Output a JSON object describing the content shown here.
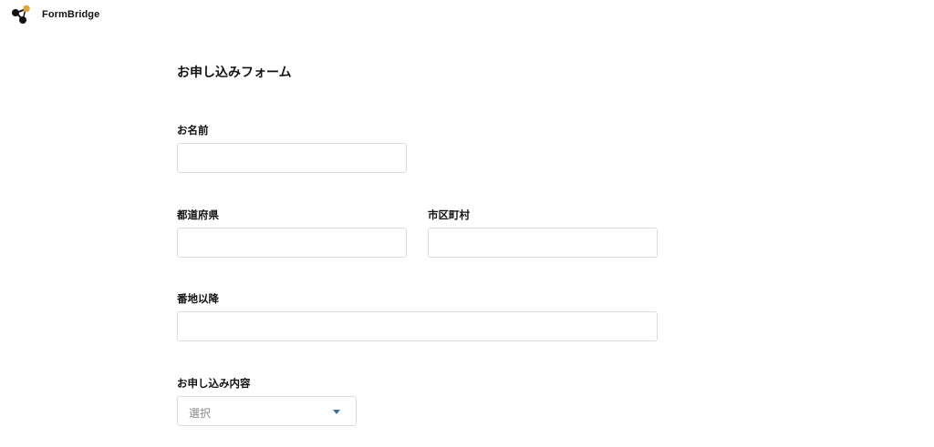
{
  "header": {
    "brand": "FormBridge",
    "logo_icon": "formbridge-logo-icon",
    "logo_colors": {
      "dark": "#111111",
      "accent": "#d9a93f"
    }
  },
  "form": {
    "title": "お申し込みフォーム",
    "fields": {
      "name": {
        "label": "お名前",
        "value": ""
      },
      "prefecture": {
        "label": "都道府県",
        "value": ""
      },
      "city": {
        "label": "市区町村",
        "value": ""
      },
      "address": {
        "label": "番地以降",
        "value": ""
      },
      "application_type": {
        "label": "お申し込み内容",
        "selected": "選択",
        "icon": "chevron-down-icon"
      }
    }
  },
  "colors": {
    "input_border": "#dcdcdc",
    "caret": "#3d6f8e",
    "placeholder_text": "#8a8a8a"
  }
}
